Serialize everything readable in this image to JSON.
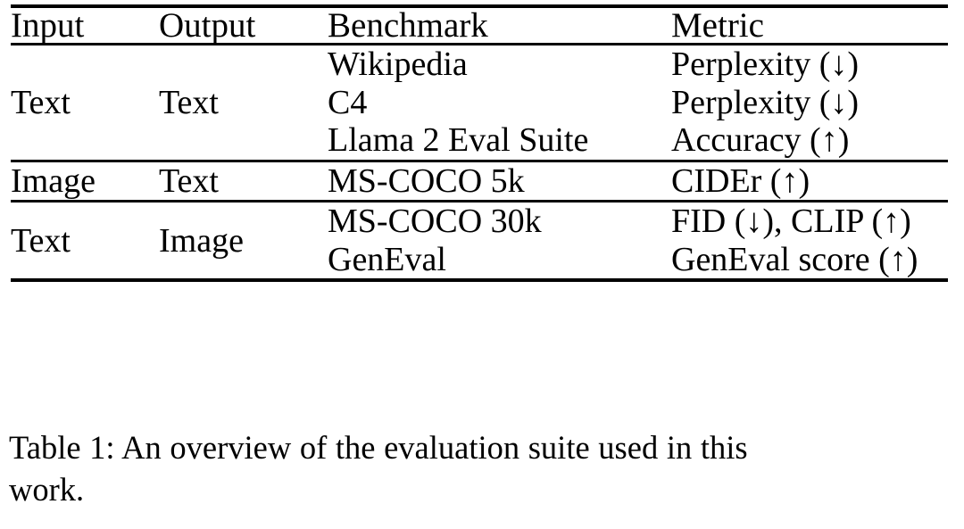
{
  "table": {
    "id": "table-1",
    "columns": [
      {
        "key": "input",
        "header": "Input"
      },
      {
        "key": "output",
        "header": "Output"
      },
      {
        "key": "benchmark",
        "header": "Benchmark"
      },
      {
        "key": "metric",
        "header": "Metric"
      }
    ],
    "groups": [
      {
        "input": "Text",
        "output": "Text",
        "benchmarks": [
          "Wikipedia",
          "C4",
          "Llama 2 Eval Suite"
        ],
        "metrics": [
          "Perplexity (↓)",
          "Perplexity (↓)",
          "Accuracy (↑)"
        ]
      },
      {
        "input": "Image",
        "output": "Text",
        "benchmarks": [
          "MS-COCO 5k"
        ],
        "metrics": [
          "CIDEr (↑)"
        ]
      },
      {
        "input": "Text",
        "output": "Image",
        "benchmarks": [
          "MS-COCO 30k",
          "GenEval"
        ],
        "metrics": [
          "FID (↓), CLIP (↑)",
          "GenEval score (↑)"
        ]
      }
    ]
  },
  "caption": {
    "lines": [
      "Table 1: An overview of the evaluation suite used in this",
      "work."
    ],
    "full_text": "Table 1: An overview of the evaluation suite used in this work."
  },
  "colors": {
    "text": "#000000",
    "background": "#ffffff",
    "rule": "#000000"
  }
}
